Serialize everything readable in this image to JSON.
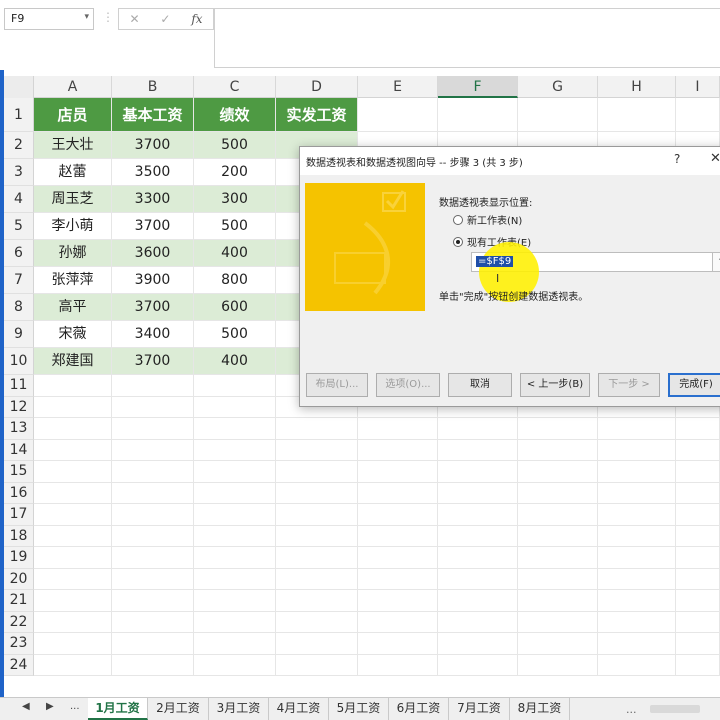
{
  "namebox": {
    "value": "F9",
    "dropdown": "▾"
  },
  "formula_buttons": {
    "cancel": "✕",
    "enter": "✓",
    "fx": "fx",
    "dots": "⋮"
  },
  "columns": [
    "A",
    "B",
    "C",
    "D",
    "E",
    "F",
    "G",
    "H",
    "I"
  ],
  "rows": [
    "1",
    "2",
    "3",
    "4",
    "5",
    "6",
    "7",
    "8",
    "9",
    "10",
    "11",
    "12",
    "13",
    "14",
    "15",
    "16",
    "17",
    "18",
    "19",
    "20",
    "21",
    "22",
    "23",
    "24"
  ],
  "table": {
    "headers": [
      "店员",
      "基本工资",
      "绩效",
      "实发工资"
    ],
    "data": [
      [
        "王大壮",
        "3700",
        "500"
      ],
      [
        "赵蕾",
        "3500",
        "200"
      ],
      [
        "周玉芝",
        "3300",
        "300"
      ],
      [
        "李小萌",
        "3700",
        "500"
      ],
      [
        "孙娜",
        "3600",
        "400"
      ],
      [
        "张萍萍",
        "3900",
        "800"
      ],
      [
        "高平",
        "3700",
        "600"
      ],
      [
        "宋薇",
        "3400",
        "500"
      ],
      [
        "郑建国",
        "3700",
        "400"
      ]
    ]
  },
  "dialog": {
    "title": "数据透视表和数据透视图向导 -- 步骤 3 (共 3 步)",
    "help": "?",
    "close": "✕",
    "location_label": "数据透视表显示位置:",
    "option_new": "新工作表(N)",
    "option_existing": "现有工作表(E)",
    "selected_option": "existing",
    "reference_value": "=$F$9",
    "ref_button": "⬆",
    "note": "单击\"完成\"按钮创建数据透视表。",
    "buttons": {
      "layout": "布局(L)...",
      "options": "选项(O)...",
      "cancel": "取消",
      "back": "< 上一步(B)",
      "next": "下一步 >",
      "finish": "完成(F)"
    }
  },
  "sheet_tabs": {
    "prev": "◀",
    "next": "▶",
    "more": "...",
    "tabs": [
      "1月工资",
      "2月工资",
      "3月工资",
      "4月工资",
      "5月工资",
      "6月工资",
      "7月工资",
      "8月工资"
    ],
    "active": "1月工资",
    "extra": "..."
  },
  "colors": {
    "header_green": "#4e9a43",
    "band_green": "#dcecd6",
    "excel_green": "#217346",
    "wizard_yellow": "#f5c300"
  }
}
